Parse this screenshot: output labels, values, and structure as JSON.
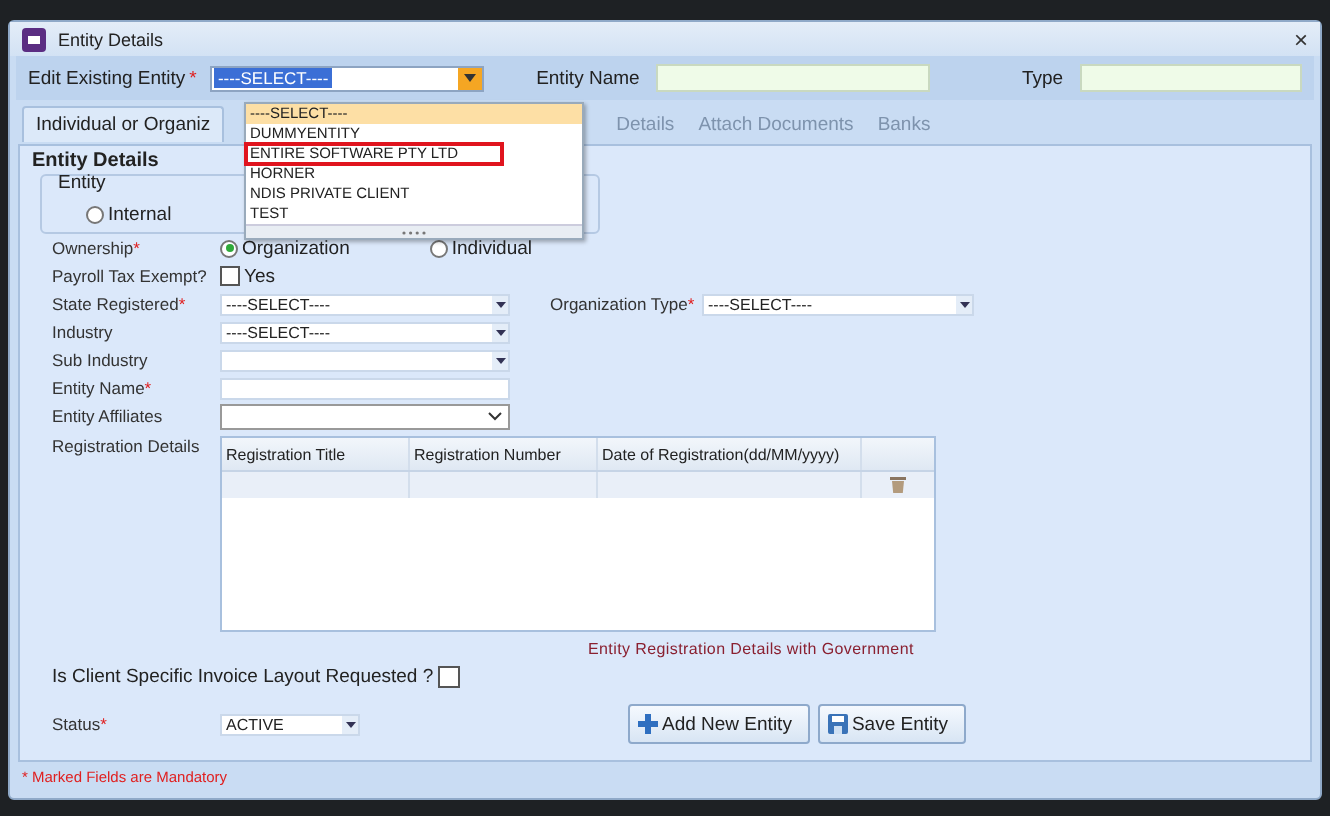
{
  "window": {
    "title": "Entity Details",
    "close": "×"
  },
  "header": {
    "edit_label": "Edit Existing Entity",
    "edit_required": "*",
    "edit_value": "----SELECT----",
    "entity_name_label": "Entity Name",
    "type_label": "Type"
  },
  "dropdown": {
    "items": [
      {
        "label": "----SELECT----",
        "selected": true,
        "annotated": false
      },
      {
        "label": "DUMMYENTITY",
        "selected": false,
        "annotated": false
      },
      {
        "label": "ENTIRE SOFTWARE PTY LTD",
        "selected": false,
        "annotated": true
      },
      {
        "label": "HORNER",
        "selected": false,
        "annotated": false
      },
      {
        "label": "NDIS PRIVATE CLIENT",
        "selected": false,
        "annotated": false
      },
      {
        "label": "TEST",
        "selected": false,
        "annotated": false
      }
    ]
  },
  "tabs": [
    {
      "label": "Individual or Organiz",
      "selected": true
    },
    {
      "label": "Details",
      "selected": false
    },
    {
      "label": "Attach Documents",
      "selected": false
    },
    {
      "label": "Banks",
      "selected": false
    }
  ],
  "panel": {
    "title": "Entity Details",
    "entity_group": {
      "title": "Entity",
      "option": "Internal",
      "selected": false
    }
  },
  "ownership": {
    "label": "Ownership",
    "required": "*",
    "options": [
      {
        "label": "Organization",
        "selected": true
      },
      {
        "label": "Individual",
        "selected": false
      }
    ]
  },
  "payroll": {
    "label": "Payroll Tax Exempt?",
    "option": "Yes",
    "checked": false
  },
  "fields": [
    {
      "kind": "select",
      "label": "State Registered",
      "required": "*",
      "value": "----SELECT----"
    },
    {
      "kind": "select",
      "label": "Industry",
      "value": "----SELECT----"
    },
    {
      "kind": "select",
      "label": "Sub Industry"
    },
    {
      "kind": "text",
      "label": "Entity Name",
      "required": "*"
    },
    {
      "kind": "combo",
      "label": "Entity Affiliates"
    }
  ],
  "org_type": {
    "label": "Organization Type",
    "required": "*",
    "value": "----SELECT----"
  },
  "registration": {
    "label": "Registration Details",
    "columns": [
      "Registration Title",
      "Registration Number",
      "Date of Registration(dd/MM/yyyy)"
    ],
    "caption": "Entity Registration Details with Government"
  },
  "invoice": {
    "label": "Is Client Specific Invoice Layout Requested ?",
    "checked": false
  },
  "status": {
    "label": "Status",
    "required": "*",
    "value": "ACTIVE"
  },
  "buttons": [
    {
      "kind": "add",
      "label": "Add New Entity"
    },
    {
      "kind": "save",
      "label": "Save Entity"
    }
  ],
  "footer": "* Marked Fields are Mandatory"
}
